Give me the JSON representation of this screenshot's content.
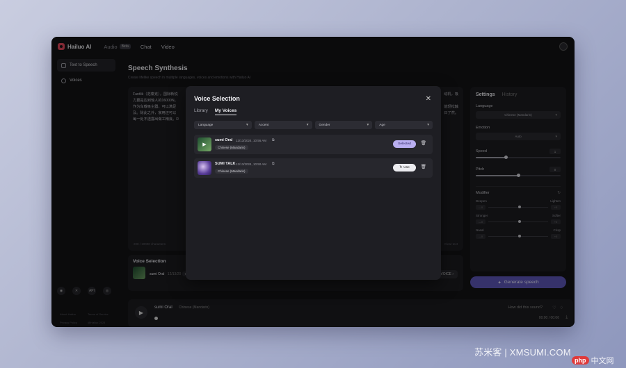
{
  "app": {
    "brand": "Hailuo AI",
    "nav": [
      {
        "label": "Audio",
        "badge": "Beta"
      },
      {
        "label": "Chat"
      },
      {
        "label": "Video"
      }
    ]
  },
  "sidebar": {
    "items": [
      {
        "label": "Text to Speech",
        "icon": "text-speech-icon"
      },
      {
        "label": "Voices",
        "icon": "voices-icon"
      }
    ],
    "social": [
      "discord-icon",
      "x-icon",
      "API",
      "globe-icon"
    ],
    "footer": [
      "About Hailuo",
      "Terms of Service",
      "Privacy Policy",
      "@Hailuo 2024"
    ]
  },
  "main": {
    "title": "Speech Synthesis",
    "subtitle": "Create lifelike speech in multiple languages, voices and emotions with Hailuo AI",
    "editor_line1": "Fantlik（范泰克），国际新锐",
    "editor_line1_right": "动机，吸",
    "editor_line2": "力更是达到惊人的16000N。",
    "editor_line3": "作为车载吸尘器，可以满足",
    "editor_line3_right": "能轻松触",
    "editor_line4": "及。除此之外，家用还可以",
    "editor_line4_right": "日了然。",
    "editor_line5": "每一处不透露出做工精良。R",
    "char_count": "208 / 10000 characters",
    "clear": "Clear text",
    "voice_selection": {
      "title": "Voice Selection",
      "name": "sumi Oral",
      "date": "12/13/20",
      "lang": "Chinese (Mandarin)",
      "change": "VOICE"
    }
  },
  "settings": {
    "tabs": [
      "Settings",
      "History"
    ],
    "language_label": "Language",
    "language_value": "Chinese (Mandarin)",
    "emotion_label": "Emotion",
    "emotion_value": "Auto",
    "speed_label": "Speed",
    "speed_value": "1",
    "speed_fraction": 0.35,
    "pitch_label": "Pitch",
    "pitch_value": "0",
    "pitch_fraction": 0.5,
    "modifier_label": "Modifier",
    "modifier_reset": "↻",
    "modifiers": [
      {
        "left": "Deepen",
        "right": "Lighten",
        "lval": "—0",
        "rval": "+0"
      },
      {
        "left": "Stronger",
        "right": "Softer",
        "lval": "—0",
        "rval": "+0"
      },
      {
        "left": "Nasal",
        "right": "Crisp",
        "lval": "—0",
        "rval": "+0"
      }
    ],
    "generate": "Generate speech"
  },
  "player": {
    "name": "sumi Oral",
    "lang": "Chinese (Mandarin)",
    "question": "How did this sound?",
    "time": "00:00 / 00:06"
  },
  "modal": {
    "title": "Voice Selection",
    "tabs": [
      "Library",
      "My Voices"
    ],
    "filters": [
      "Language",
      "Accent",
      "Gender",
      "Age"
    ],
    "voices": [
      {
        "name": "sumi Oral",
        "date": "12/13/2024, 10:56 AM",
        "lang": "Chinese (Mandarin)",
        "action": "Selected"
      },
      {
        "name": "SUMI TALK",
        "date": "12/13/2024, 10:50 AM",
        "lang": "Chinese (Mandarin)",
        "action": "Use"
      }
    ]
  },
  "watermark": {
    "site": "苏米客 | XMSUMI.COM",
    "php_badge": "php",
    "cn": "中文网"
  },
  "colors": {
    "accent": "#5e56b8",
    "selected_badge": "#b9aef0",
    "brand_red": "#e0475a"
  }
}
